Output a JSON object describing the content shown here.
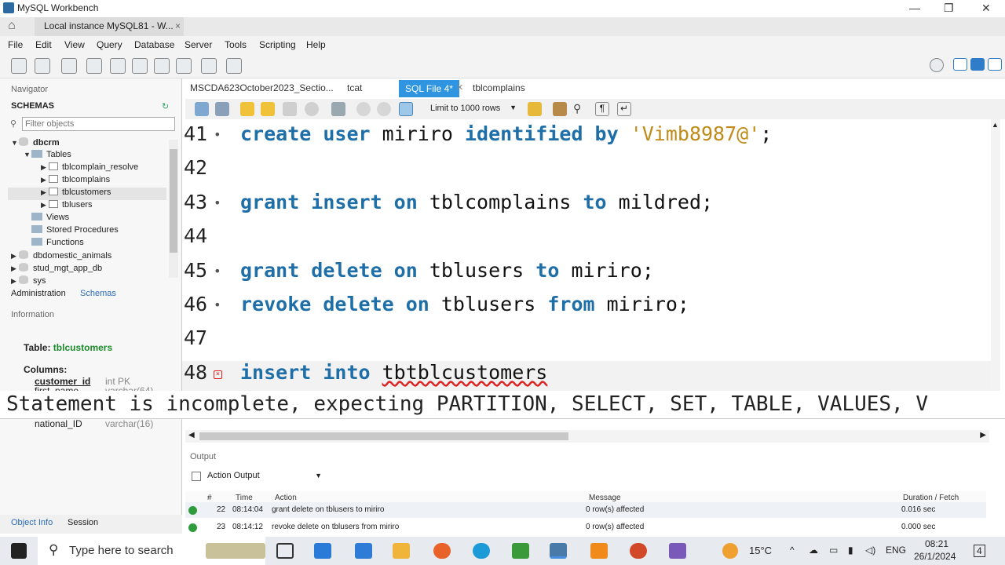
{
  "window": {
    "title": "MySQL Workbench",
    "minimize": "—",
    "maximize": "❐",
    "close": "✕"
  },
  "conn_tab": {
    "label": "Local instance MySQL81 - W...",
    "close": "×"
  },
  "menu": [
    "File",
    "Edit",
    "View",
    "Query",
    "Database",
    "Server",
    "Tools",
    "Scripting",
    "Help"
  ],
  "navigator": {
    "title": "Navigator",
    "schemas_label": "SCHEMAS",
    "filter_placeholder": "Filter objects",
    "tree": {
      "db1": "dbcrm",
      "tables": "Tables",
      "t1": "tblcomplain_resolve",
      "t2": "tblcomplains",
      "t3": "tblcustomers",
      "t4": "tblusers",
      "views": "Views",
      "procs": "Stored Procedures",
      "funcs": "Functions",
      "db2": "dbdomestic_animals",
      "db3": "stud_mgt_app_db",
      "db4": "sys"
    },
    "tab_admin": "Administration",
    "tab_schemas": "Schemas",
    "info_title": "Information",
    "table_label": "Table:",
    "table_name": "tblcustomers",
    "columns_label": "Columns:",
    "columns": [
      {
        "name": "customer_id",
        "type": "int PK"
      },
      {
        "name": "first_name",
        "type": "varchar(64)"
      },
      {
        "name": "national_ID",
        "type": "varchar(16)"
      }
    ],
    "tab_objinfo": "Object Info",
    "tab_session": "Session"
  },
  "editor_tabs": [
    "MSCDA623October2023_Sectio...",
    "tcat",
    "SQL File 4*",
    "tblcomplains"
  ],
  "limit_select": "Limit to 1000 rows",
  "code_lines": [
    {
      "num": "41",
      "marker": "•",
      "parts": [
        [
          "kw",
          "create user "
        ],
        [
          "id",
          "miriro "
        ],
        [
          "kw",
          "identified by "
        ],
        [
          "str",
          "'Vimb8987@'"
        ],
        [
          "id",
          ";"
        ]
      ]
    },
    {
      "num": "42",
      "marker": "",
      "parts": []
    },
    {
      "num": "43",
      "marker": "•",
      "parts": [
        [
          "kw",
          "grant insert on "
        ],
        [
          "id",
          "tblcomplains "
        ],
        [
          "kw",
          "to "
        ],
        [
          "id",
          "mildred;"
        ]
      ]
    },
    {
      "num": "44",
      "marker": "",
      "parts": []
    },
    {
      "num": "45",
      "marker": "•",
      "parts": [
        [
          "kw",
          "grant delete on "
        ],
        [
          "id",
          "tblusers "
        ],
        [
          "kw",
          "to "
        ],
        [
          "id",
          "miriro;"
        ]
      ]
    },
    {
      "num": "46",
      "marker": "•",
      "parts": [
        [
          "kw",
          "revoke delete on "
        ],
        [
          "id",
          "tblusers "
        ],
        [
          "kw",
          "from "
        ],
        [
          "id",
          "miriro;"
        ]
      ]
    },
    {
      "num": "47",
      "marker": "",
      "parts": []
    },
    {
      "num": "48",
      "marker": "×",
      "parts": [
        [
          "kw",
          "insert into "
        ],
        [
          "sq",
          "tbtblcustomers"
        ]
      ]
    }
  ],
  "error_tooltip": "Statement is incomplete, expecting PARTITION, SELECT, SET, TABLE, VALUES, V",
  "output": {
    "title": "Output",
    "mode": "Action Output",
    "headers": {
      "num": "#",
      "time": "Time",
      "action": "Action",
      "message": "Message",
      "duration": "Duration / Fetch"
    },
    "rows": [
      {
        "num": "22",
        "time": "08:14:04",
        "action": "grant delete on tblusers to miriro",
        "message": "0 row(s) affected",
        "duration": "0.016 sec"
      },
      {
        "num": "23",
        "time": "08:14:12",
        "action": "revoke delete on tblusers from miriro",
        "message": "0 row(s) affected",
        "duration": "0.000 sec"
      }
    ]
  },
  "taskbar": {
    "search": "Type here to search",
    "weather": "15°C",
    "lang": "ENG",
    "time": "08:21",
    "date": "26/1/2024",
    "notif": "4"
  },
  "colors": {
    "keyword": "#1e6ea8",
    "string": "#c08a18",
    "active_tab": "#2f95e0"
  }
}
